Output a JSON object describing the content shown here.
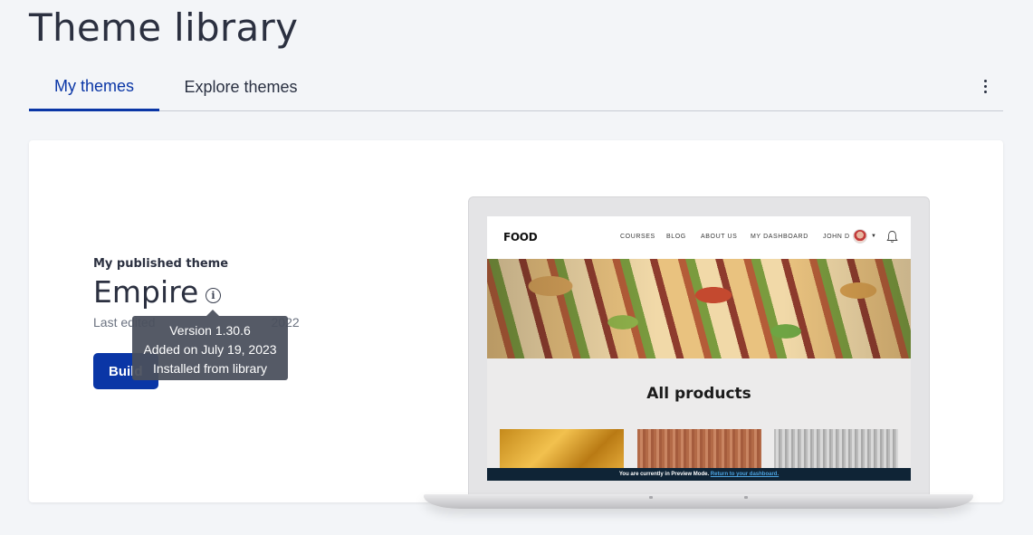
{
  "page": {
    "title": "Theme library"
  },
  "tabs": [
    {
      "label": "My themes",
      "active": true
    },
    {
      "label": "Explore themes",
      "active": false
    }
  ],
  "published": {
    "section_label": "My published theme",
    "theme_name": "Empire",
    "last_edited": "Last edited",
    "last_edited_suffix": "2022",
    "build_label": "Build"
  },
  "tooltip": {
    "version": "Version 1.30.6",
    "added": "Added on July 19, 2023",
    "source": "Installed from library"
  },
  "preview": {
    "logo": "FOOD",
    "nav": [
      "COURSES",
      "BLOG",
      "ABOUT US",
      "MY DASHBOARD",
      "JOHN D"
    ],
    "heading": "All products",
    "preview_text": "You are currently in Preview Mode.",
    "preview_link": "Return to your dashboard."
  },
  "colors": {
    "accent": "#0a36a6",
    "background": "#f3f5f8",
    "tooltip": "#4a505c"
  },
  "icons": [
    "kebab-menu-icon",
    "info-icon",
    "bell-icon",
    "caret-down-icon"
  ]
}
